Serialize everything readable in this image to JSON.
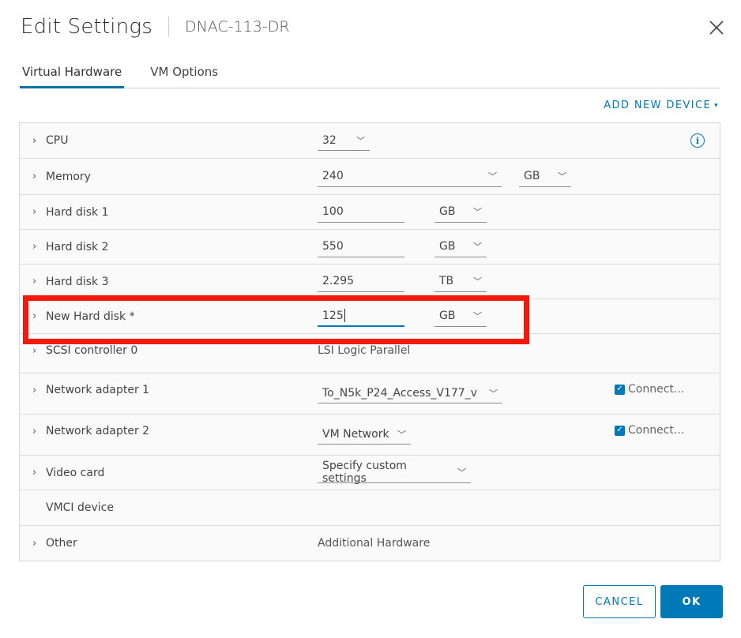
{
  "dialog": {
    "title": "Edit Settings",
    "subtitle": "DNAC-113-DR",
    "close_icon": "close-icon"
  },
  "tabs": [
    {
      "label": "Virtual Hardware",
      "active": true
    },
    {
      "label": "VM Options",
      "active": false
    }
  ],
  "add_new_device": {
    "label": "ADD NEW DEVICE",
    "icon": "chevron-down-icon"
  },
  "rows": {
    "cpu": {
      "label": "CPU",
      "value": "32",
      "info_icon": "info-icon"
    },
    "memory": {
      "label": "Memory",
      "value": "240",
      "unit": "GB"
    },
    "hard_disk_1": {
      "label": "Hard disk 1",
      "value": "100",
      "unit": "GB"
    },
    "hard_disk_2": {
      "label": "Hard disk 2",
      "value": "550",
      "unit": "GB"
    },
    "hard_disk_3": {
      "label": "Hard disk 3",
      "value": "2.295",
      "unit": "TB"
    },
    "new_hard_disk": {
      "label": "New Hard disk *",
      "value": "125",
      "unit": "GB"
    },
    "scsi_controller": {
      "label": "SCSI controller 0",
      "value": "LSI Logic Parallel"
    },
    "network_adapter_1": {
      "label": "Network adapter 1",
      "value": "To_N5k_P24_Access_V177_v",
      "connect_label": "Connect...",
      "connected": true
    },
    "network_adapter_2": {
      "label": "Network adapter 2",
      "value": "VM Network",
      "connect_label": "Connect...",
      "connected": true
    },
    "video_card": {
      "label": "Video card",
      "value": "Specify custom settings"
    },
    "vmci_device": {
      "label": "VMCI device"
    },
    "other": {
      "label": "Other",
      "value": "Additional Hardware"
    }
  },
  "glyphs": {
    "caret_right": "›",
    "chevron_down": "⌄",
    "check": "✓",
    "info": "i"
  },
  "highlight": {
    "target": "new_hard_disk",
    "color": "#f21a0c"
  },
  "colors": {
    "accent": "#0079b8",
    "highlight_border": "#f21a0c",
    "tab_indicator": "#0072a3"
  },
  "footer": {
    "cancel_label": "CANCEL",
    "ok_label": "OK"
  }
}
